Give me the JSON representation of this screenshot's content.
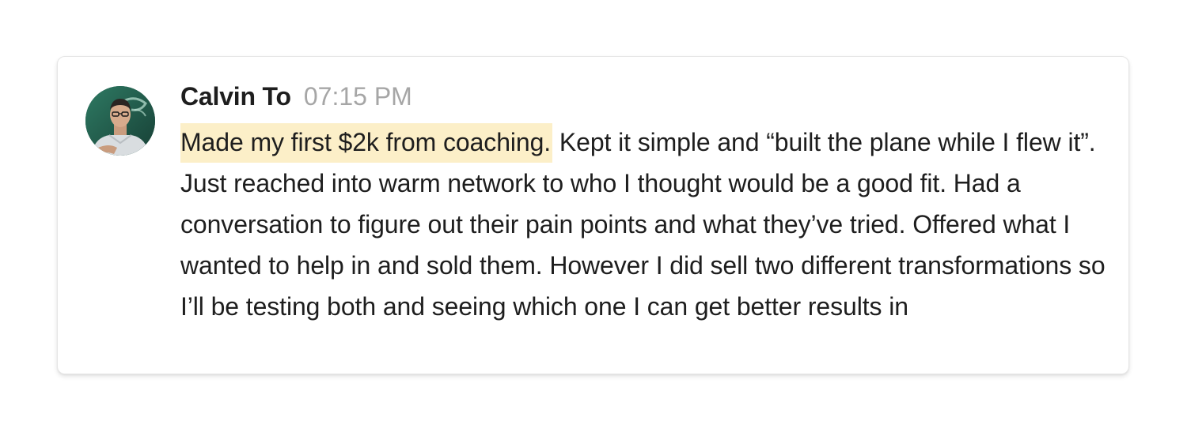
{
  "message": {
    "author_name": "Calvin To",
    "timestamp": "07:15 PM",
    "highlighted_text": "Made my first $2k from coaching.",
    "body_text": " Kept it simple and “built the plane while I flew it”. Just reached into warm network  to who I thought would be a good fit. Had a conversation to figure out their pain points and what they’ve tried. Offered what I wanted to help in and sold them. However I did sell two different transformations so I’ll be testing both and seeing which one I can get better results in"
  },
  "colors": {
    "highlight": "#fcefc8",
    "text": "#1e1e1e",
    "timestamp": "#a6a6a6",
    "card_border": "#e6e6e6"
  }
}
